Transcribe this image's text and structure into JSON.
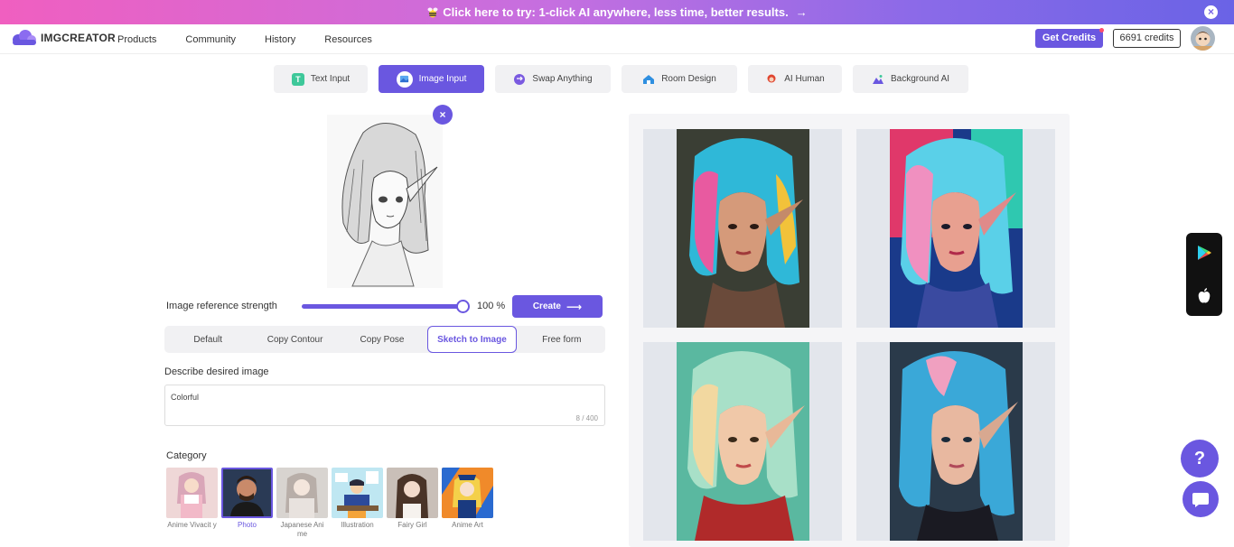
{
  "banner": {
    "text": "Click here to try: 1-click AI anywhere, less time, better results."
  },
  "nav": {
    "brand": "IMGCREATOR",
    "links": [
      "Products",
      "Community",
      "History",
      "Resources"
    ],
    "get_credits": "Get Credits",
    "credits": "6691 credits"
  },
  "tabs": [
    {
      "label": "Text Input",
      "icon": "text-icon"
    },
    {
      "label": "Image Input",
      "icon": "image-icon"
    },
    {
      "label": "Swap Anything",
      "icon": "swap-icon"
    },
    {
      "label": "Room Design",
      "icon": "house-icon"
    },
    {
      "label": "AI Human",
      "icon": "human-icon"
    },
    {
      "label": "Background AI",
      "icon": "mountain-icon"
    }
  ],
  "strength": {
    "label": "Image reference strength",
    "value": "100 %",
    "level": 1.0
  },
  "create_label": "Create",
  "modes": [
    "Default",
    "Copy Contour",
    "Copy Pose",
    "Sketch to Image",
    "Free form"
  ],
  "describe": {
    "label": "Describe desired image",
    "value": "Colorful",
    "counter": "8 / 400"
  },
  "category": {
    "label": "Category",
    "items": [
      "Anime Vivacit y",
      "Photo",
      "Japanese Ani me",
      "Illustration",
      "Fairy Girl",
      "Anime Art"
    ]
  },
  "colors": {
    "accent": "#6a57e0",
    "banner_start": "#f05fc0",
    "banner_end": "#6a63e6"
  }
}
